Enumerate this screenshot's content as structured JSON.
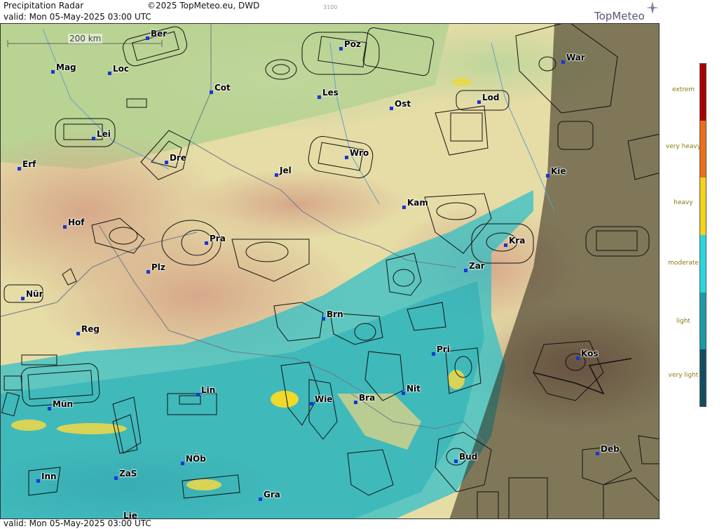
{
  "header": {
    "title": "Precipitation Radar",
    "copyright": "©2025 TopMeteo.eu, DWD",
    "valid": "valid:  Mon  05-May-2025 03:00 UTC",
    "code": "3100",
    "logo": "TopMeteo"
  },
  "footer": {
    "valid": "valid:  Mon  05-May-2025 03:00 UTC"
  },
  "scale_bar": {
    "label": "200 km"
  },
  "cities": [
    {
      "name": "Ber"
    },
    {
      "name": "Poz"
    },
    {
      "name": "War"
    },
    {
      "name": "Mag"
    },
    {
      "name": "Loc"
    },
    {
      "name": "Cot"
    },
    {
      "name": "Les"
    },
    {
      "name": "Ost"
    },
    {
      "name": "Lod"
    },
    {
      "name": "Lei"
    },
    {
      "name": "Wro"
    },
    {
      "name": "Dre"
    },
    {
      "name": "Erf"
    },
    {
      "name": "Jel"
    },
    {
      "name": "Kie"
    },
    {
      "name": "Kam"
    },
    {
      "name": "Hof"
    },
    {
      "name": "Pra"
    },
    {
      "name": "Kra"
    },
    {
      "name": "Plz"
    },
    {
      "name": "Zar"
    },
    {
      "name": "Nür"
    },
    {
      "name": "Brn"
    },
    {
      "name": "Reg"
    },
    {
      "name": "Pri"
    },
    {
      "name": "Kos"
    },
    {
      "name": "Nit"
    },
    {
      "name": "Lin"
    },
    {
      "name": "Wie"
    },
    {
      "name": "Bra"
    },
    {
      "name": "Mün"
    },
    {
      "name": "Bud"
    },
    {
      "name": "Deb"
    },
    {
      "name": "NÖb"
    },
    {
      "name": "Inn"
    },
    {
      "name": "ZaS"
    },
    {
      "name": "Gra"
    },
    {
      "name": "Lie"
    }
  ],
  "legend": {
    "labels": [
      "extrem",
      "very heavy",
      "heavy",
      "moderate",
      "light",
      "very light"
    ],
    "colors": [
      "#a80000",
      "#e8701a",
      "#f5d21b",
      "#28d6e0",
      "#1a9aa8",
      "#134e5e"
    ]
  }
}
